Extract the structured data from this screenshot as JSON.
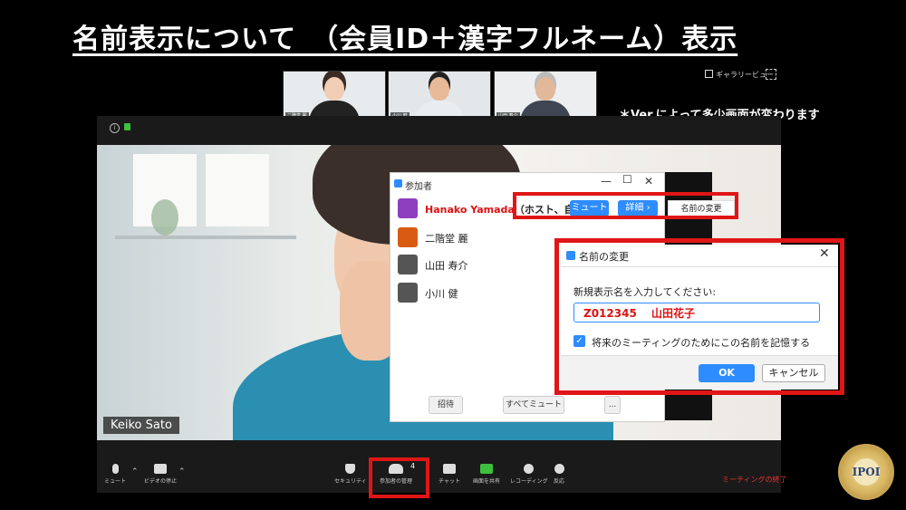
{
  "slide": {
    "title": "名前表示について　（会員ID＋漢字フルネーム）表示",
    "note": "＊Ver.によって多少画面が変わります",
    "gallery_view": "ギャラリービュー"
  },
  "thumbnails": [
    {
      "name": "二階堂 麗"
    },
    {
      "name": "小川 健"
    },
    {
      "name": "山田 寿介"
    }
  ],
  "video": {
    "name_label": "Keiko Sato"
  },
  "participants_panel": {
    "title": "参加者",
    "host": {
      "name": "Hanako Yamada",
      "role": "（ホスト、自分）",
      "avatar_color": "#8e3fbf"
    },
    "mute_label": "ミュート",
    "details_label": "詳細 ›",
    "rename_label": "名前の変更",
    "others": [
      {
        "name": "二階堂 麗",
        "avatar_color": "#d95b12"
      },
      {
        "name": "山田 寿介",
        "avatar_color": "#555555"
      },
      {
        "name": "小川 健",
        "avatar_color": "#555555"
      }
    ],
    "invite_label": "招待",
    "mute_all_label": "すべてミュート",
    "more_label": "..."
  },
  "rename_dialog": {
    "title": "名前の変更",
    "prompt": "新規表示名を入力してください:",
    "value": "Z012345　 山田花子",
    "remember_label": "将来のミーティングのためにこの名前を記憶する",
    "ok_label": "OK",
    "cancel_label": "キャンセル"
  },
  "toolbar": {
    "mute": "ミュート",
    "video_stop": "ビデオの停止",
    "security": "セキュリティ",
    "participants": "参加者の管理",
    "participants_count": "4",
    "chat": "チャット",
    "share_screen": "画面を共有",
    "recording": "レコーディング",
    "reaction": "反応",
    "end_meeting": "ミーティングの終了"
  },
  "seal": {
    "text": "IPOI"
  },
  "colors": {
    "accent": "#2d8cff",
    "highlight": "#e01616",
    "host_name": "#dd1111"
  }
}
